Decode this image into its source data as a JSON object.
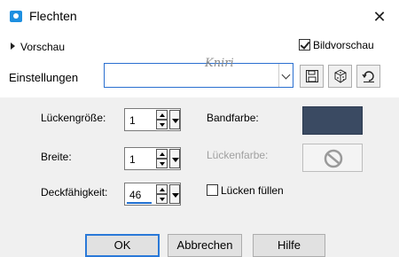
{
  "window": {
    "title": "Flechten",
    "close_glyph": "✕"
  },
  "preview": {
    "toggle_label": "Vorschau",
    "checkbox_label": "Bildvorschau",
    "checked": true
  },
  "settings": {
    "label": "Einstellungen",
    "value": "",
    "watermark": "Kniri"
  },
  "fields": {
    "gap_size": {
      "label": "Lückengröße:",
      "value": "1"
    },
    "width": {
      "label": "Breite:",
      "value": "1"
    },
    "opacity": {
      "label": "Deckfähigkeit:",
      "value": "46"
    }
  },
  "colors": {
    "band_label": "Bandfarbe:",
    "band_color": "#3a4a62",
    "gap_label": "Lückenfarbe:"
  },
  "fill_gaps": {
    "label": "Lücken füllen",
    "checked": false
  },
  "buttons": {
    "ok": "OK",
    "cancel": "Abbrechen",
    "help": "Hilfe"
  }
}
